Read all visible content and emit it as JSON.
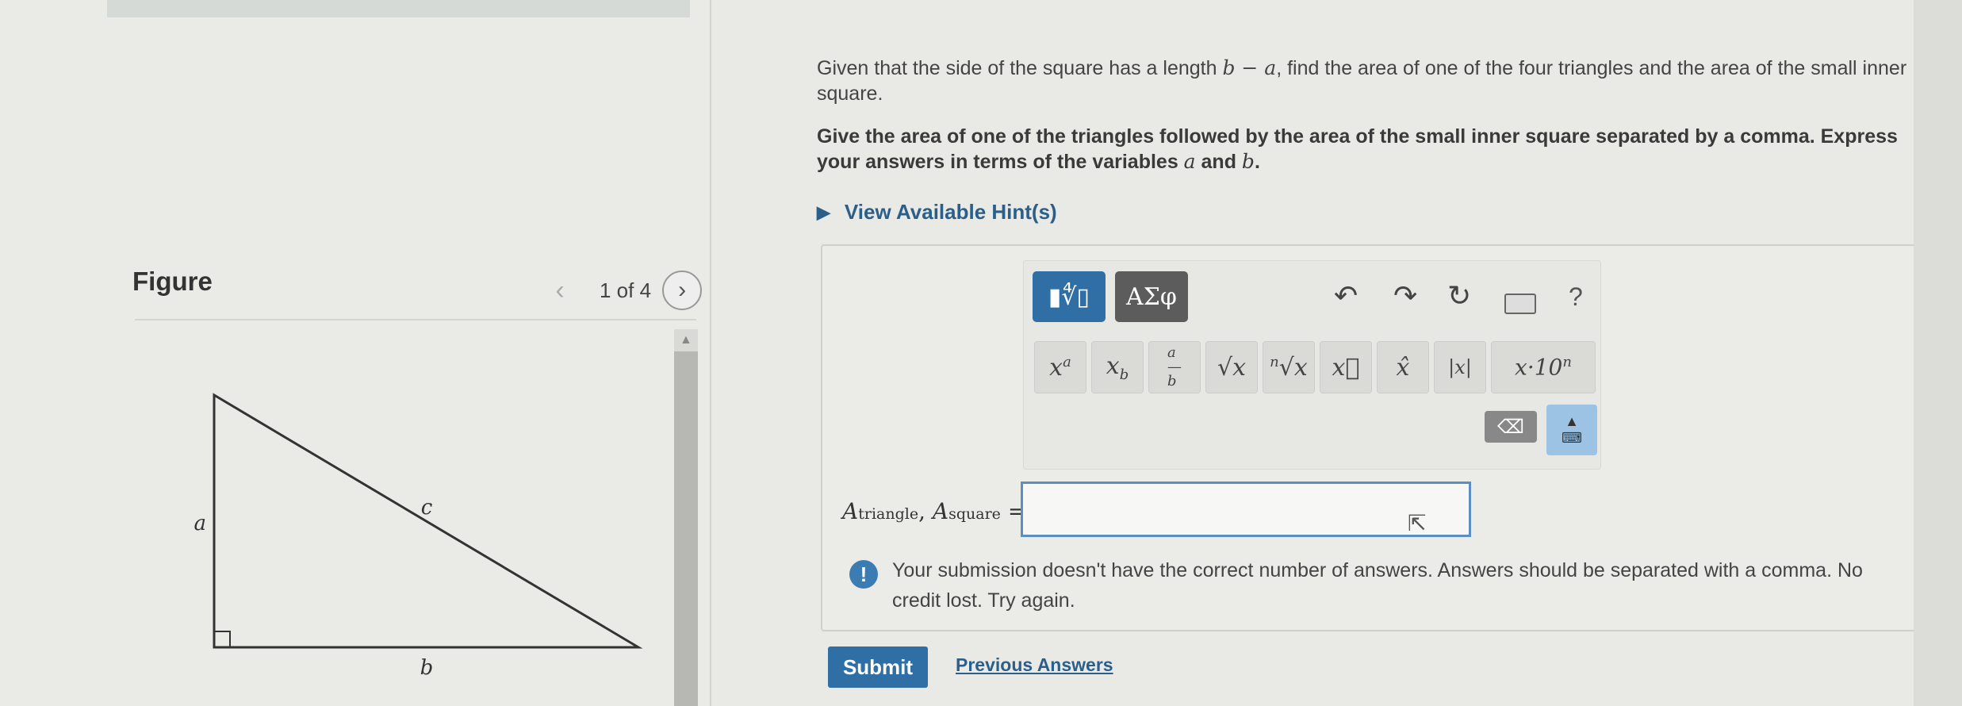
{
  "figure": {
    "title": "Figure",
    "pager_text": "1 of 4",
    "labels": {
      "a": "a",
      "b": "b",
      "c": "c"
    }
  },
  "problem": {
    "prompt_prefix": "Given that the side of the square has a length ",
    "prompt_math": "b − a",
    "prompt_suffix": ", find the area of one of the four triangles and the area of the small inner square.",
    "instruction_prefix": "Give the area of one of the triangles followed by the area of the small inner square separated by a comma. Express your answers in terms of the variables ",
    "var_a": "a",
    "instruction_mid": " and ",
    "var_b": "b",
    "instruction_suffix": ".",
    "hints_label": "View Available Hint(s)"
  },
  "toolbar": {
    "template_btn": "▮∜▯",
    "greek_btn": "ΑΣφ",
    "undo_icon": "↶",
    "redo_icon": "↷",
    "reset_icon": "↻",
    "help": "?",
    "templates": [
      "xᵃ",
      "x_b",
      "a/b",
      "√x",
      "ⁿ√x",
      "x⃗",
      "x̂",
      "|x|",
      "x·10ⁿ"
    ],
    "backspace": "⌫"
  },
  "answer": {
    "label_A1": "A",
    "label_sub1": "triangle",
    "label_sep": ", ",
    "label_A2": "A",
    "label_sub2": "square",
    "label_eq": " =",
    "value": ""
  },
  "feedback": {
    "icon": "!",
    "text": "Your submission doesn't have the correct number of answers. Answers should be separated with a comma. No credit lost. Try again."
  },
  "actions": {
    "submit": "Submit",
    "previous_answers": "Previous Answers"
  },
  "colors": {
    "accent": "#2f6fa6",
    "link": "#2b5f8a",
    "input_border": "#5a8fc0"
  }
}
